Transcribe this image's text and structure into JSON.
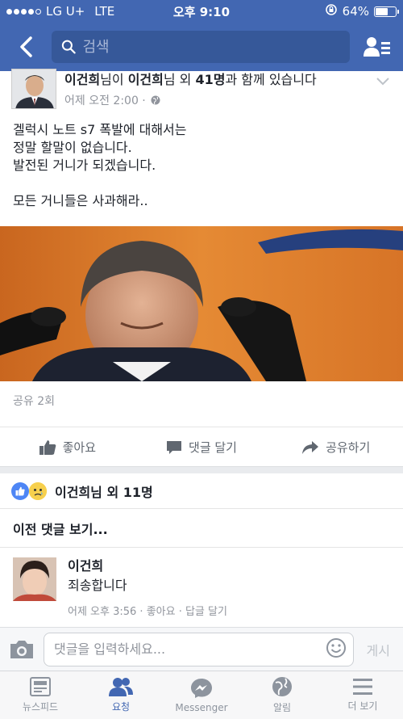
{
  "status": {
    "carrier": "LG U+",
    "network": "LTE",
    "time": "오후 9:10",
    "battery": "64%",
    "battery_level": 0.64
  },
  "header": {
    "search_placeholder": "검색"
  },
  "post": {
    "author": "이건희",
    "with_text": "님이 ",
    "tagged": "이건희",
    "with_text2": "님 외 ",
    "tagged_count": "41명",
    "with_text3": "과 함께 있습니다",
    "time": "어제 오전 2:00 · ",
    "lines": [
      "겔럭시 노트 s7 폭발에 대해서는",
      "정말 할말이 없습니다.",
      "발전된 거니가 되겠습니다.",
      "",
      "모든 거니들은 사과해라.."
    ],
    "shares": "공유 2회",
    "actions": {
      "like": "좋아요",
      "comment": "댓글 달기",
      "share": "공유하기"
    }
  },
  "reactions": {
    "text": "이건희님 외 11명"
  },
  "comments": {
    "view_previous": "이전 댓글 보기...",
    "items": [
      {
        "name": "이건희",
        "text": "죄송합니다",
        "meta": "어제 오후 3:56 · 좋아요 · 답글 달기"
      }
    ]
  },
  "composer": {
    "placeholder": "댓글을 입력하세요...",
    "post_label": "게시"
  },
  "tabs": [
    {
      "label": "뉴스피드",
      "icon": "news-feed-icon"
    },
    {
      "label": "요청",
      "icon": "friend-requests-icon",
      "active": true
    },
    {
      "label": "Messenger",
      "icon": "messenger-icon"
    },
    {
      "label": "알림",
      "icon": "globe-icon"
    },
    {
      "label": "더 보기",
      "icon": "menu-icon"
    }
  ],
  "colors": {
    "brand": "#4267b2",
    "background": "#e9ebee",
    "secondary_text": "#90949c"
  }
}
